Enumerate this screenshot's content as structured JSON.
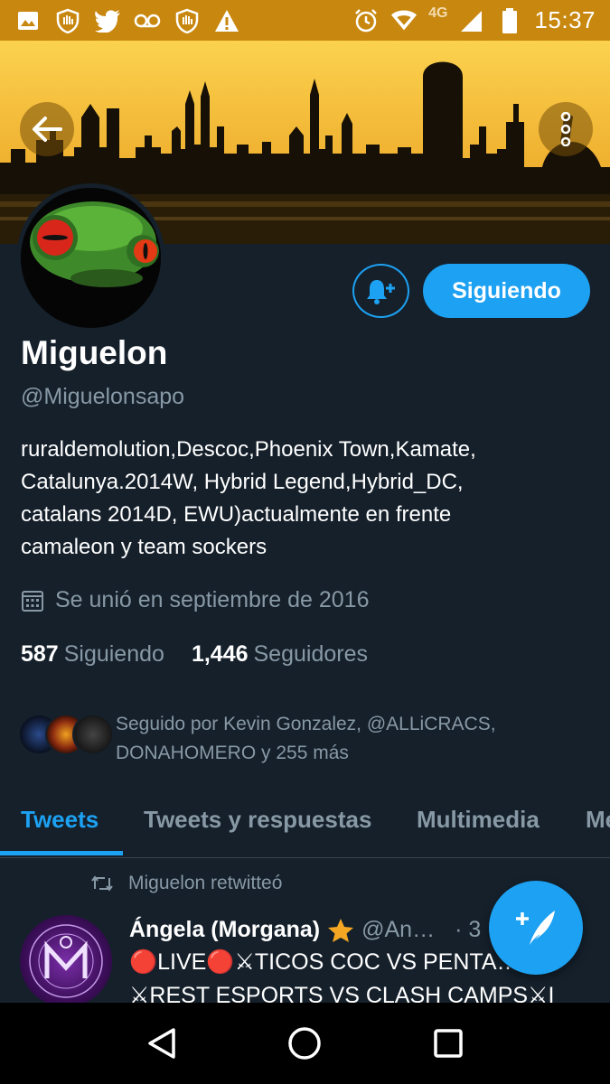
{
  "status_bar": {
    "time": "15:37",
    "network": "4G",
    "icons": [
      "image-icon",
      "shield-hand-icon",
      "twitter-bird-icon",
      "voicemail-icon",
      "shield-hand-icon",
      "warning-icon",
      "alarm-icon",
      "wifi-icon",
      "signal-icon",
      "battery-icon"
    ]
  },
  "profile": {
    "name": "Miguelon",
    "handle": "@Miguelonsapo",
    "bio_lines": [
      "ruraldemolution,Descoc,Phoenix Town,Kamate,",
      "Catalunya.2014W, Hybrid Legend,Hybrid_DC,",
      "catalans 2014D, EWU)actualmente en frente",
      "camaleon y team sockers"
    ],
    "joined": "Se unió en septiembre de 2016",
    "following_count": "587",
    "following_label": "Siguiendo",
    "followers_count": "1,446",
    "followers_label": "Seguidores",
    "followed_by_line1": "Seguido por Kevin Gonzalez, @ALLiCRACS,",
    "followed_by_line2": "DONAHOMERO y 255 más"
  },
  "actions": {
    "follow_button": "Siguiendo"
  },
  "tabs": [
    "Tweets",
    "Tweets y respuestas",
    "Multimedia",
    "Me"
  ],
  "tweet": {
    "retweet_label": "Miguelon retwitteó",
    "author_name": "Ángela (Morgana)",
    "author_handle": "@An…",
    "time": "· 3",
    "line1": "🔴LIVE🔴⚔TICOS COC VS PENTA…",
    "line2": "⚔REST ESPORTS VS CLASH CAMPS⚔I"
  },
  "colors": {
    "background": "#15202b",
    "accent": "#1da1f2",
    "secondary_text": "#8899a6",
    "status_bar": "#c8870e"
  }
}
